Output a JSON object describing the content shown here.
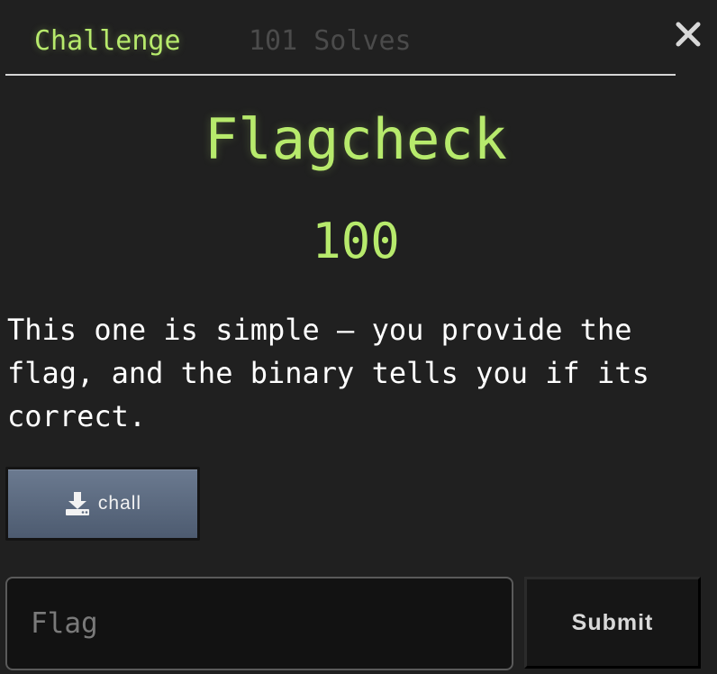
{
  "tabs": [
    {
      "label": "Challenge",
      "active": true
    },
    {
      "label": "101 Solves",
      "active": false
    }
  ],
  "close_icon": "close-icon",
  "challenge": {
    "name": "Flagcheck",
    "points": "100",
    "description": "This one is simple – you provide the flag, and the binary tells you if its correct.",
    "file": {
      "label": "chall",
      "icon": "download-icon"
    }
  },
  "form": {
    "flag_placeholder": "Flag",
    "flag_value": "",
    "submit_label": "Submit"
  },
  "colors": {
    "accent": "#b7ea6c",
    "background": "#202020",
    "inactive_tab": "#4b4b4b",
    "download_button": "#5d6b80"
  }
}
